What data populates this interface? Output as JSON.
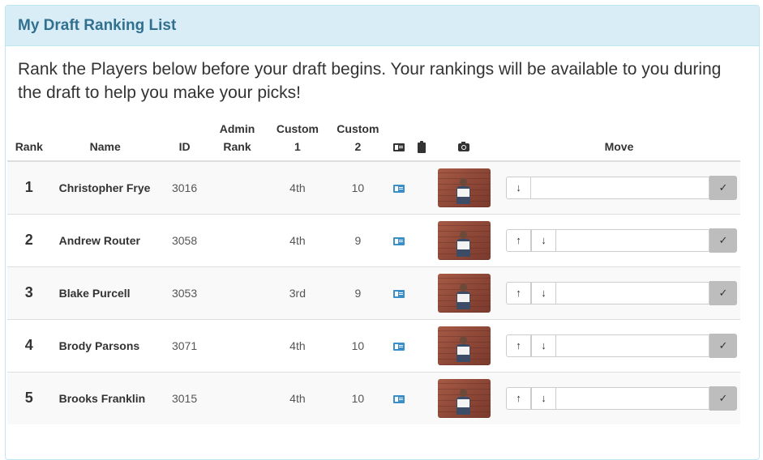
{
  "panel": {
    "title": "My Draft Ranking List",
    "intro": "Rank the Players below before your draft begins. Your rankings will be available to you during the draft to help you make your picks!"
  },
  "table": {
    "headers": {
      "rank": "Rank",
      "name": "Name",
      "id": "ID",
      "admin_rank_1": "Admin",
      "admin_rank_2": "Rank",
      "custom1_1": "Custom",
      "custom1_2": "1",
      "custom2_1": "Custom",
      "custom2_2": "2",
      "card_icon": "id-card-icon",
      "clipboard_icon": "clipboard-icon",
      "camera_icon": "camera-icon",
      "move": "Move"
    },
    "rows": [
      {
        "rank": "1",
        "name": "Christopher Frye",
        "id": "3016",
        "admin_rank": "",
        "custom1": "4th",
        "custom2": "10",
        "up": "",
        "down": "↓",
        "check": "✓"
      },
      {
        "rank": "2",
        "name": "Andrew Router",
        "id": "3058",
        "admin_rank": "",
        "custom1": "4th",
        "custom2": "9",
        "up": "↑",
        "down": "↓",
        "check": "✓"
      },
      {
        "rank": "3",
        "name": "Blake Purcell",
        "id": "3053",
        "admin_rank": "",
        "custom1": "3rd",
        "custom2": "9",
        "up": "↑",
        "down": "↓",
        "check": "✓"
      },
      {
        "rank": "4",
        "name": "Brody Parsons",
        "id": "3071",
        "admin_rank": "",
        "custom1": "4th",
        "custom2": "10",
        "up": "↑",
        "down": "↓",
        "check": "✓"
      },
      {
        "rank": "5",
        "name": "Brooks Franklin",
        "id": "3015",
        "admin_rank": "",
        "custom1": "4th",
        "custom2": "10",
        "up": "↑",
        "down": "↓",
        "check": "✓"
      }
    ]
  },
  "colors": {
    "heading_bg": "#d9edf7",
    "heading_text": "#31708f",
    "card_icon": "#3a8fc9",
    "confirm_button": "#bdbdbd"
  }
}
